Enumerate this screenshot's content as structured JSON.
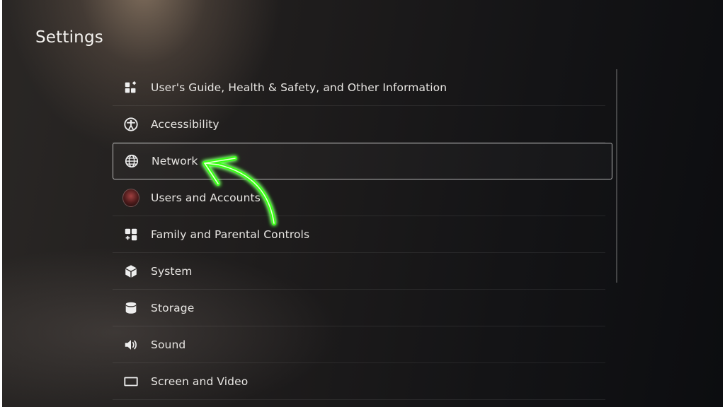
{
  "page": {
    "title": "Settings"
  },
  "menu": {
    "items": [
      {
        "label": "User's Guide, Health & Safety, and Other Information",
        "icon": "info-blocks-icon"
      },
      {
        "label": "Accessibility",
        "icon": "accessibility-icon"
      },
      {
        "label": "Network",
        "icon": "globe-icon",
        "selected": true
      },
      {
        "label": "Users and Accounts",
        "icon": "avatar"
      },
      {
        "label": "Family and Parental Controls",
        "icon": "family-icon"
      },
      {
        "label": "System",
        "icon": "cube-icon"
      },
      {
        "label": "Storage",
        "icon": "storage-icon"
      },
      {
        "label": "Sound",
        "icon": "speaker-icon"
      },
      {
        "label": "Screen and Video",
        "icon": "screen-icon"
      }
    ]
  },
  "annotation": {
    "color": "#39ff14",
    "icon": "green-arrow-annotation"
  }
}
